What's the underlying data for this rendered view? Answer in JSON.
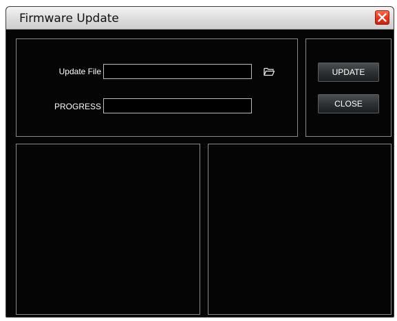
{
  "window": {
    "title": "Firmware Update",
    "close_icon": "close-icon"
  },
  "form": {
    "update_file_label": "Update File",
    "update_file_value": "",
    "progress_label": "PROGRESS",
    "progress_value": 0,
    "browse_icon": "folder-open-icon"
  },
  "actions": {
    "update_label": "UPDATE",
    "close_label": "CLOSE"
  },
  "colors": {
    "background": "#050505",
    "titlebar": "#dcdcdc",
    "panel_border": "#8c8c8c",
    "close_button": "#e8321c",
    "text": "#ffffff"
  }
}
